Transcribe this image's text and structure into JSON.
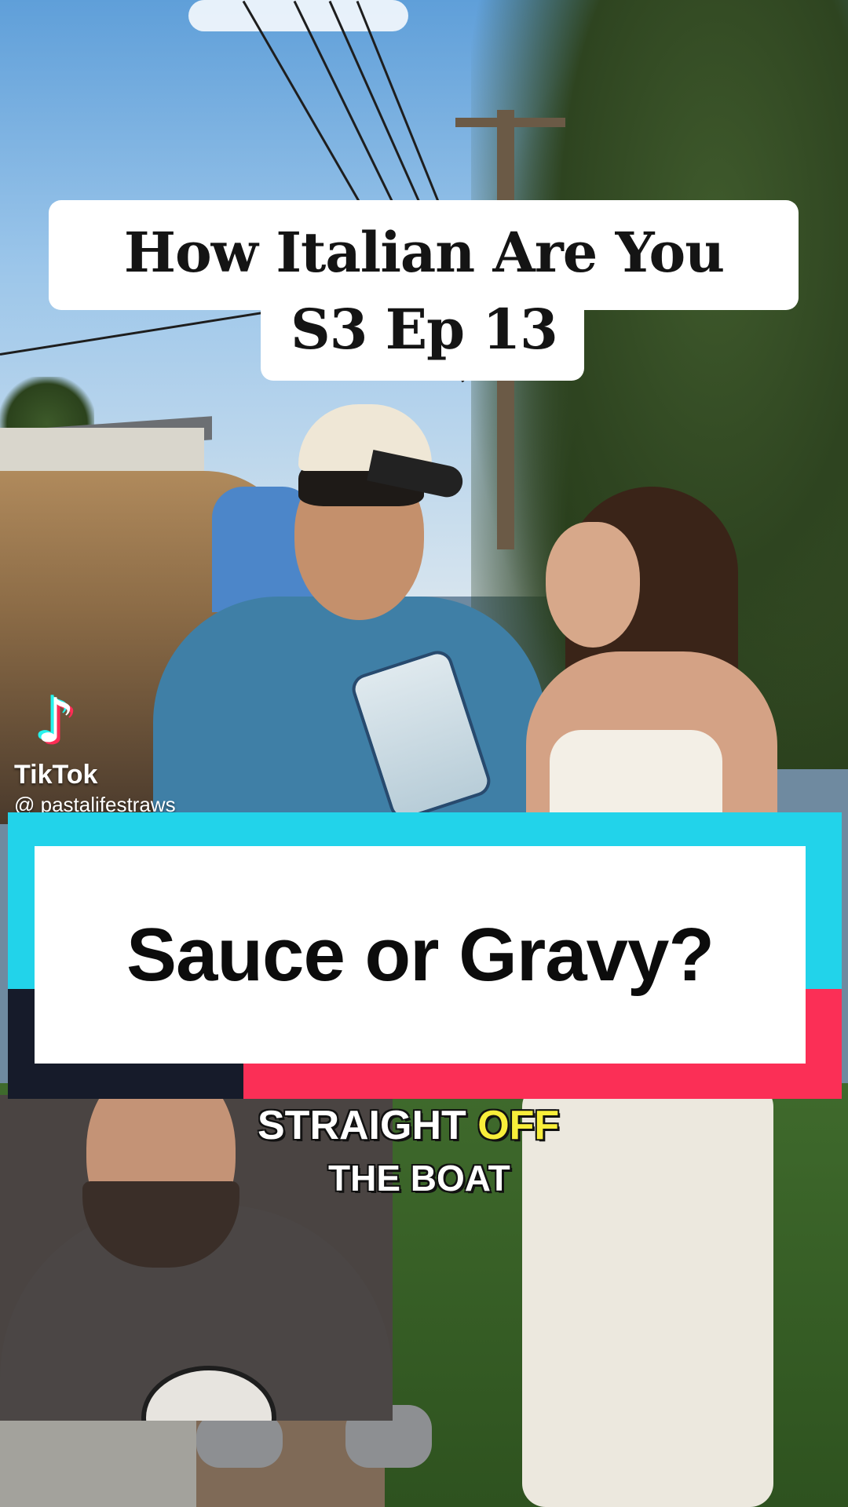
{
  "video": {
    "title_line1": "How Italian Are You",
    "title_line2": "S3 Ep 13",
    "question": "Sauce or Gravy?",
    "caption_word1": "STRAIGHT",
    "caption_word2": "OFF",
    "caption_line2": "THE BOAT"
  },
  "watermark": {
    "icon": "tiktok-note-icon",
    "brand": "TikTok",
    "handle": "@ pastalifestraws"
  },
  "colors": {
    "banner_cyan": "#22d3ea",
    "banner_red": "#fb2f56",
    "banner_dark": "#161b2a",
    "caption_highlight": "#f8ee3a"
  }
}
